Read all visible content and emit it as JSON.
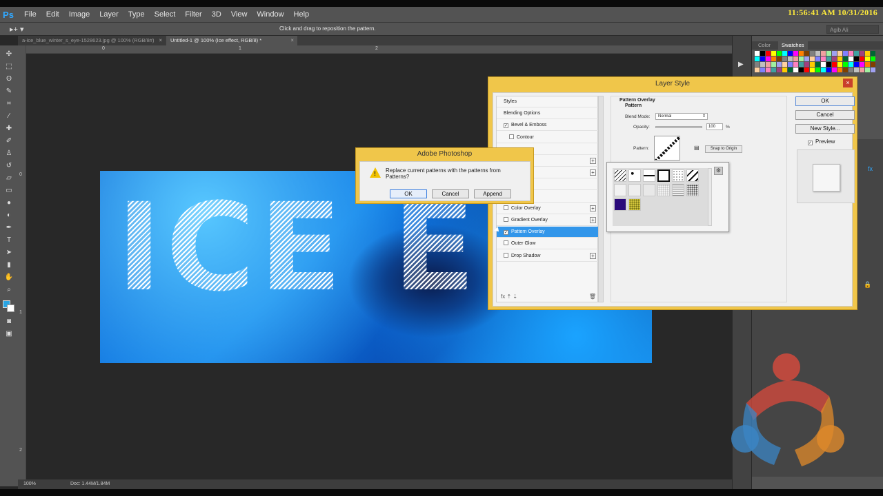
{
  "app": {
    "logo": "Ps",
    "menu": [
      "File",
      "Edit",
      "Image",
      "Layer",
      "Type",
      "Select",
      "Filter",
      "3D",
      "View",
      "Window",
      "Help"
    ],
    "clock": "11:56:41 AM 10/31/2016"
  },
  "options_bar": {
    "tool_glyph": "▸+ ▾",
    "hint": "Click and drag to reposition the pattern.",
    "workspace": "Agib Ali"
  },
  "tabs": [
    {
      "label": "a-ice_blue_winter_s_eye-1528623.jpg @ 100% (RGB/8#)",
      "close": "×"
    },
    {
      "label": "Untitled-1 @ 100% (Ice effect, RGB/8) *",
      "close": "×"
    }
  ],
  "rulers": {
    "top": [
      "0",
      "1",
      "2"
    ],
    "left": [
      "0",
      "1",
      "2"
    ]
  },
  "canvas": {
    "text": "ICE EFFECT"
  },
  "status": {
    "zoom": "100%",
    "doc": "Doc: 1.44M/1.84M"
  },
  "panels": {
    "color_tab": "Color",
    "swatches_tab": "Swatches",
    "swatch_colors": [
      "#ffffff",
      "#000000",
      "#ff0000",
      "#ffff00",
      "#00ff00",
      "#00ffff",
      "#0000ff",
      "#ff00ff",
      "#ff8000",
      "#804000",
      "#808080",
      "#c0c0c0",
      "#f0a0a0",
      "#a0f0a0",
      "#a0a0f0",
      "#ffd0a0",
      "#8080ff",
      "#ff80c0",
      "#40a0a0",
      "#a04080",
      "#ffcc00",
      "#006633"
    ]
  },
  "layer_style": {
    "title": "Layer Style",
    "close": "×",
    "styles": [
      {
        "label": "Styles",
        "checkbox": false,
        "plus": false,
        "checked": false
      },
      {
        "label": "Blending Options",
        "checkbox": false,
        "plus": false,
        "checked": false
      },
      {
        "label": "Bevel & Emboss",
        "checkbox": true,
        "plus": false,
        "checked": true
      },
      {
        "label": "Contour",
        "checkbox": true,
        "plus": false,
        "checked": false
      },
      {
        "label": "",
        "checkbox": false,
        "plus": false,
        "checked": false
      },
      {
        "label": "",
        "checkbox": false,
        "plus": true,
        "checked": false
      },
      {
        "label": "",
        "checkbox": false,
        "plus": true,
        "checked": false
      },
      {
        "label": "",
        "checkbox": false,
        "plus": false,
        "checked": false
      },
      {
        "label": "",
        "checkbox": false,
        "plus": false,
        "checked": false
      },
      {
        "label": "Color Overlay",
        "checkbox": true,
        "plus": true,
        "checked": false
      },
      {
        "label": "Gradient Overlay",
        "checkbox": true,
        "plus": true,
        "checked": false
      },
      {
        "label": "Pattern Overlay",
        "checkbox": true,
        "plus": false,
        "checked": true,
        "selected": true
      },
      {
        "label": "Outer Glow",
        "checkbox": true,
        "plus": false,
        "checked": false
      },
      {
        "label": "Drop Shadow",
        "checkbox": true,
        "plus": true,
        "checked": false
      }
    ],
    "footer_icons": "fx  ⇡  ⇣",
    "trash_icon": "🗑",
    "section_title": "Pattern Overlay",
    "section_sub": "Pattern",
    "blend_mode_label": "Blend Mode:",
    "blend_mode_value": "Normal",
    "opacity_label": "Opacity:",
    "opacity_value": "100",
    "opacity_unit": "%",
    "pattern_label": "Pattern:",
    "snap_label": "Snap to Origin",
    "buttons": {
      "ok": "OK",
      "cancel": "Cancel",
      "new_style": "New Style..."
    },
    "preview_label": "Preview",
    "preview_checked": true
  },
  "alert": {
    "title": "Adobe Photoshop",
    "message": "Replace current patterns with the patterns from Patterns?",
    "buttons": {
      "ok": "OK",
      "cancel": "Cancel",
      "append": "Append"
    }
  }
}
